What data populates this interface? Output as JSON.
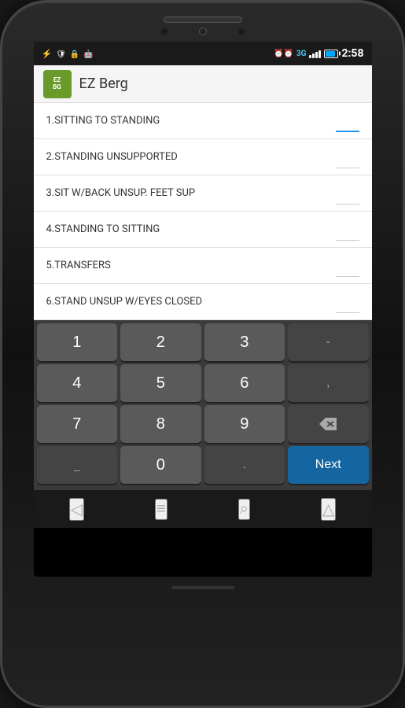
{
  "phone": {
    "status_bar": {
      "time": "2:58",
      "network": "3G",
      "icons_left": [
        "usb",
        "shield",
        "lock",
        "android"
      ],
      "icons_right": [
        "alarm",
        "3g",
        "signal",
        "battery"
      ]
    },
    "app_bar": {
      "title": "EZ Berg",
      "icon_text": "EZ\nBG"
    },
    "list_items": [
      {
        "id": 1,
        "label": "1.SITTING TO STANDING",
        "has_value": true,
        "value": ""
      },
      {
        "id": 2,
        "label": "2.STANDING UNSUPPORTED",
        "has_value": false,
        "value": ""
      },
      {
        "id": 3,
        "label": "3.SIT W/BACK UNSUP. FEET SUP",
        "has_value": false,
        "value": ""
      },
      {
        "id": 4,
        "label": "4.STANDING TO SITTING",
        "has_value": false,
        "value": ""
      },
      {
        "id": 5,
        "label": "5.TRANSFERS",
        "has_value": false,
        "value": ""
      },
      {
        "id": 6,
        "label": "6.STAND UNSUP W/EYES CLOSED",
        "has_value": false,
        "value": ""
      }
    ],
    "keyboard": {
      "rows": [
        [
          "1",
          "2",
          "3",
          "-"
        ],
        [
          "4",
          "5",
          "6",
          ","
        ],
        [
          "7",
          "8",
          "9",
          "⌫"
        ],
        [
          "_",
          "0",
          ".",
          "Next"
        ]
      ]
    },
    "nav": {
      "back": "◁",
      "menu": "≡",
      "search": "⌕",
      "home": "△"
    }
  }
}
